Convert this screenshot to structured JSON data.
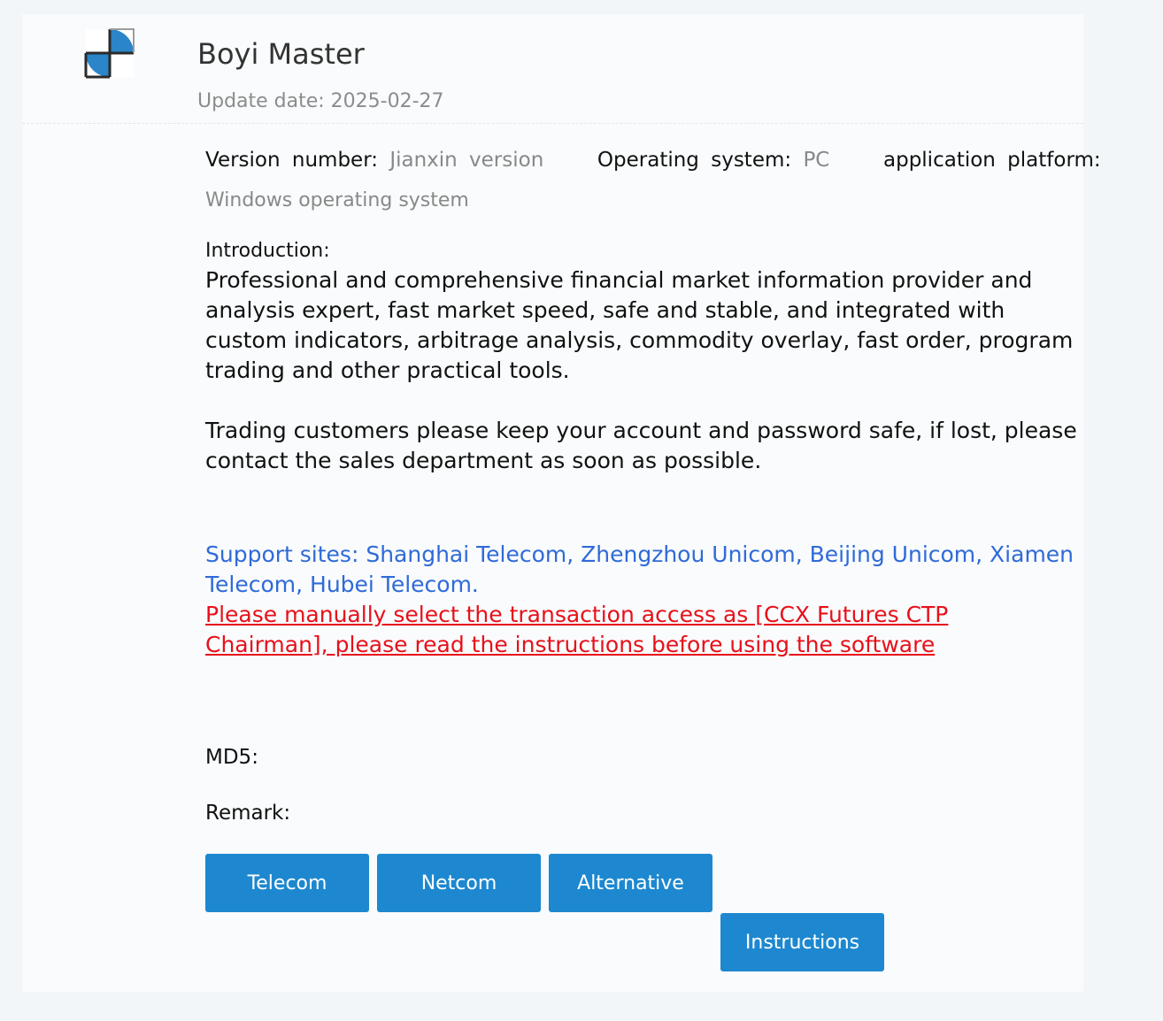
{
  "app": {
    "title": "Boyi Master",
    "update_date": "Update date: 2025-02-27",
    "logo_colors": [
      "#2b85c8",
      "#ffffff"
    ]
  },
  "meta": {
    "version_label": "Version number:",
    "version_value": "Jianxin version",
    "os_label": "Operating system:",
    "os_value": "PC",
    "platform_label": "application platform:",
    "platform_value": "Windows operating system"
  },
  "intro": {
    "label": "Introduction:",
    "paragraph1": "Professional and comprehensive financial market information provider and analysis expert, fast market speed, safe and stable, and integrated with custom indicators, arbitrage analysis, commodity overlay, fast order, program trading and other practical tools.",
    "paragraph2": "Trading customers please keep your account and password safe, if lost, please contact the sales department as soon as possible."
  },
  "support_sites": "Support sites: Shanghai Telecom, Zhengzhou Unicom, Beijing Unicom, Xiamen Telecom, Hubei Telecom.",
  "warning_link": "Please manually select the transaction access as [CCX Futures CTP Chairman], please read the instructions before using the software",
  "md5_label": "MD5:",
  "remark_label": "Remark:",
  "buttons": {
    "telecom": "Telecom",
    "netcom": "Netcom",
    "alternative": "Alternative",
    "instructions": "Instructions"
  },
  "colors": {
    "accent": "#1d88cf",
    "support_text": "#2f6ad8",
    "warning_text": "#e8101a"
  }
}
